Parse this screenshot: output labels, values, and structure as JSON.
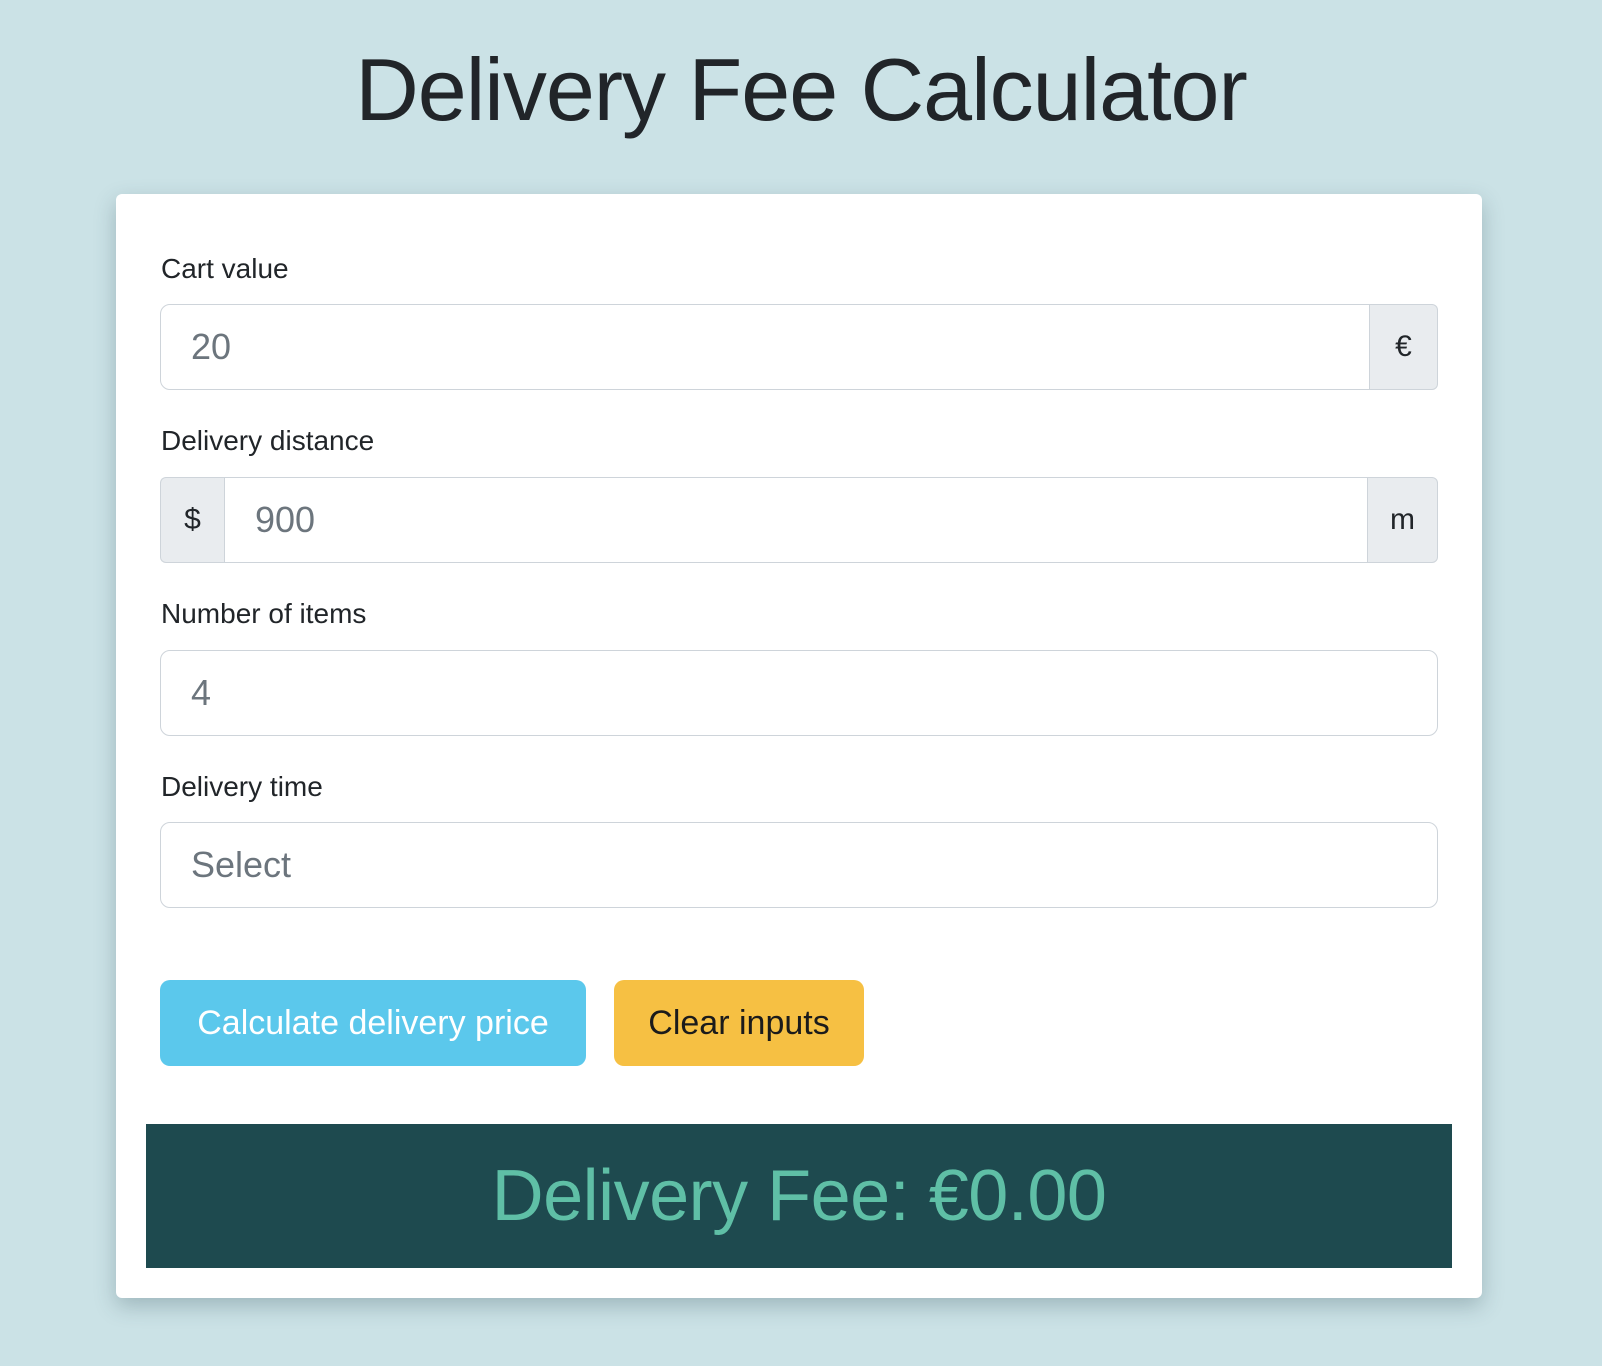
{
  "header": {
    "title": "Delivery Fee Calculator"
  },
  "form": {
    "cart_value": {
      "label": "Cart value",
      "value": "20",
      "suffix": "€"
    },
    "delivery_distance": {
      "label": "Delivery distance",
      "value": "900",
      "prefix": "$",
      "suffix": "m"
    },
    "number_of_items": {
      "label": "Number of items",
      "value": "4"
    },
    "delivery_time": {
      "label": "Delivery time",
      "selected": "Select"
    }
  },
  "actions": {
    "calculate_label": "Calculate delivery price",
    "clear_label": "Clear inputs"
  },
  "result": {
    "text": "Delivery Fee: €0.00"
  },
  "colors": {
    "background": "#cbe2e6",
    "calculate_button": "#5bc8ec",
    "clear_button": "#f6c043",
    "result_banner": "#1e4a4f",
    "result_text": "#5fbfa6"
  }
}
